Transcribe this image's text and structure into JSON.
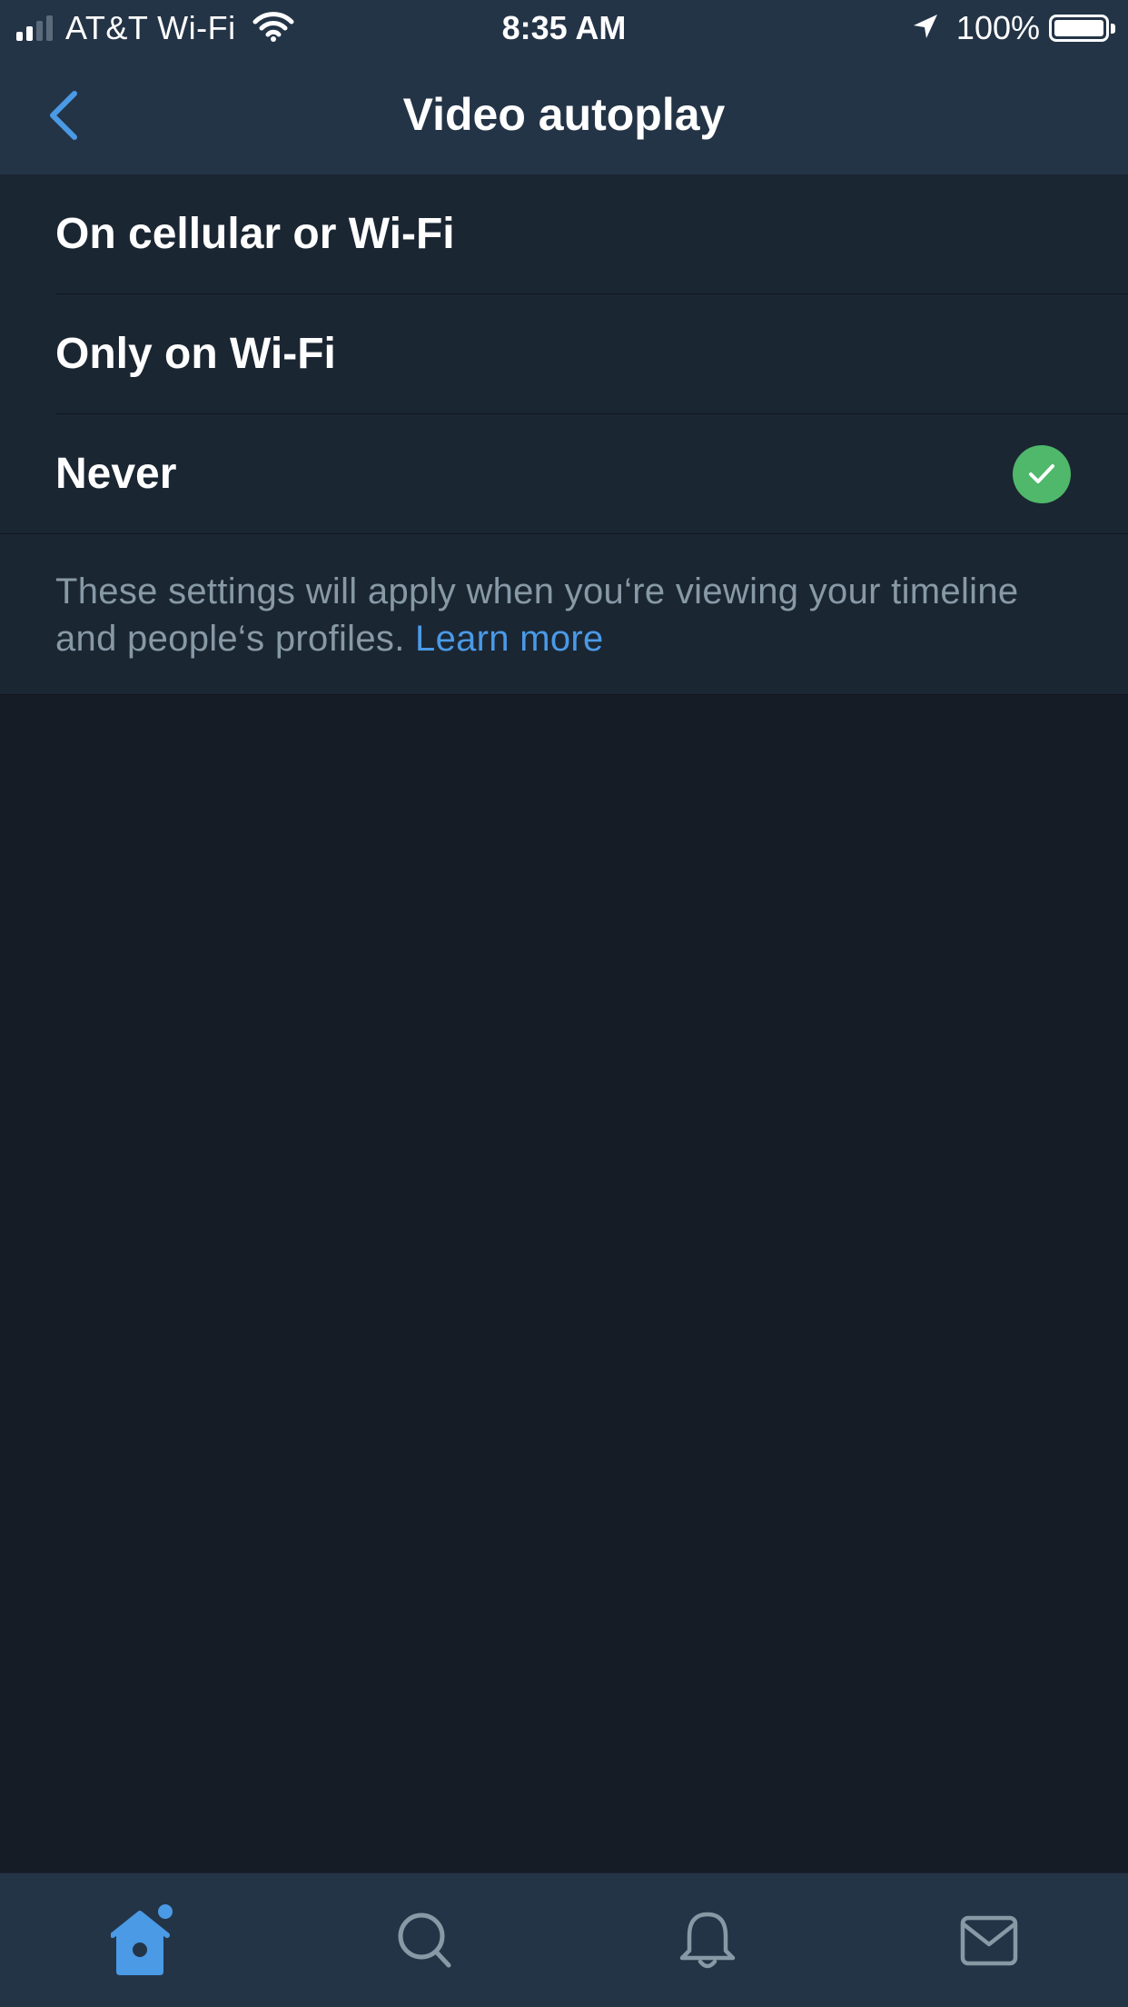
{
  "status_bar": {
    "carrier": "AT&T Wi-Fi",
    "time": "8:35 AM",
    "battery": "100%",
    "icons": [
      "signal-icon",
      "wifi-icon",
      "location-arrow-icon",
      "battery-icon"
    ]
  },
  "nav": {
    "title": "Video autoplay",
    "back_icon": "chevron-left-icon"
  },
  "options": [
    {
      "label": "On cellular or Wi-Fi",
      "selected": false
    },
    {
      "label": "Only on Wi-Fi",
      "selected": false
    },
    {
      "label": "Never",
      "selected": true
    }
  ],
  "footnote": {
    "text": "These settings will apply when you‘re viewing your timeline and people‘s profiles. ",
    "link": "Learn more"
  },
  "tab_bar": {
    "tabs": [
      {
        "icon": "home-icon",
        "active": true
      },
      {
        "icon": "search-icon",
        "active": false
      },
      {
        "icon": "notifications-bell-icon",
        "active": false
      },
      {
        "icon": "messages-envelope-icon",
        "active": false
      }
    ]
  },
  "colors": {
    "accent": "#4a9ae6",
    "selected_check": "#4fb86a",
    "background": "#161c26",
    "bar_background": "#243447",
    "row_background": "#1b2633",
    "muted_text": "#8899a6"
  }
}
